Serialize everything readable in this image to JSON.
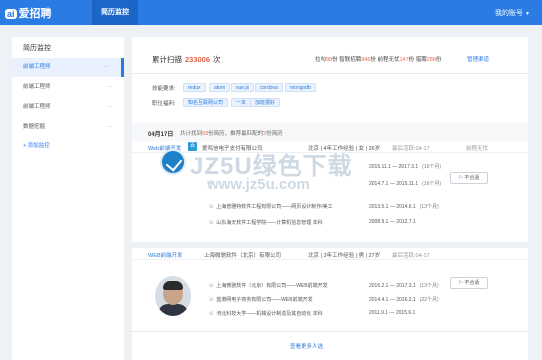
{
  "header": {
    "logo_mark": "ai",
    "logo_text": "爱招聘",
    "active_tab": "简历监控",
    "account": "我的账号"
  },
  "sidebar": {
    "title": "简历监控",
    "items": [
      {
        "label": "前端工程师",
        "more": "···"
      },
      {
        "label": "前端工程师",
        "more": "···"
      },
      {
        "label": "前端工程师",
        "more": "···"
      },
      {
        "label": "数据挖掘",
        "more": "···"
      }
    ],
    "add_label": "+ 添加监控"
  },
  "scan": {
    "label": "累计扫描",
    "count": "233006",
    "unit": "次"
  },
  "stats": {
    "lagou_label": "拉勾",
    "lagou_count": "98",
    "zhilian_label": "智联招聘",
    "zhilian_count": "846",
    "qiancheng_label": "前程无忧",
    "qiancheng_count": "147",
    "lieping_label": "猎聘",
    "lieping_count": "286",
    "unit": "份",
    "manage_link": "管理渠道"
  },
  "filters": {
    "skills_label": "技能要求:",
    "skills": [
      "redux",
      "atom",
      "vue.js",
      "cordova",
      "mongodb"
    ],
    "benefits_label": "职位福利:",
    "benefits": [
      "知名互联网公司",
      "一本",
      "加班很好"
    ]
  },
  "summary": {
    "date": "04月17日",
    "text_prefix": "共计找到",
    "found": "93",
    "text_middle": "份简历，推荐最匹配的",
    "matched": "2",
    "text_suffix": "份简历"
  },
  "cards": [
    {
      "position": "Web前端开发",
      "tier": "百",
      "company": "爱鸣信电子支付有限公司",
      "location": "北京",
      "experience": "4年工作经验",
      "gender": "女",
      "age": "26岁",
      "latest_sync": "最后活跃:04-17",
      "collect": "前程无忧",
      "experiences": [
        {
          "icon": "⊙",
          "text": "",
          "period": "2015.11.1 — 2017.3.1",
          "duration": "(16个月)"
        },
        {
          "icon": "⊙",
          "text": "",
          "period": "2014.7.1 — 2015.11.1",
          "duration": "(16个月)"
        },
        {
          "icon": "⊙",
          "text": "上海普雅特软件工程有限公司——网页设计制作/美工",
          "period": "2013.5.1 — 2014.6.1",
          "duration": "(13个月)"
        },
        {
          "icon": "⊙",
          "text": "山东海天软件工程学院——计算机信息管理 本科",
          "period": "2008.9.1 — 2012.7.1",
          "duration": ""
        }
      ],
      "skip_label": "不合适"
    },
    {
      "position": "WEB前端开发",
      "company": "上海微驰软件（北京）有限公司",
      "location": "北京",
      "experience": "3年工作经验",
      "gender": "男",
      "age": "27岁",
      "latest_sync": "最后活跃:04-17",
      "experiences": [
        {
          "icon": "⊙",
          "text": "上海微驰软件（北京）有限公司——WEB前端开发",
          "period": "2016.2.1 — 2017.3.1",
          "duration": "(13个月)"
        },
        {
          "icon": "⊙",
          "text": "蓝港网电子商务有限公司——WEB前端开发",
          "period": "2014.4.1 — 2016.2.1",
          "duration": "(22个月)"
        },
        {
          "icon": "⊙",
          "text": "河北科技大学——机械设计制造及其自动化 本科",
          "period": "2011.9.1 — 2015.6.1",
          "duration": ""
        }
      ],
      "skip_label": "不合适"
    }
  ],
  "more_label": "查看更多人选",
  "watermark": {
    "text": "JZ5U绿色下载",
    "url": "www.jz5u.com"
  },
  "colors": {
    "brand": "#2a7be4",
    "highlight": "#e8664a"
  }
}
